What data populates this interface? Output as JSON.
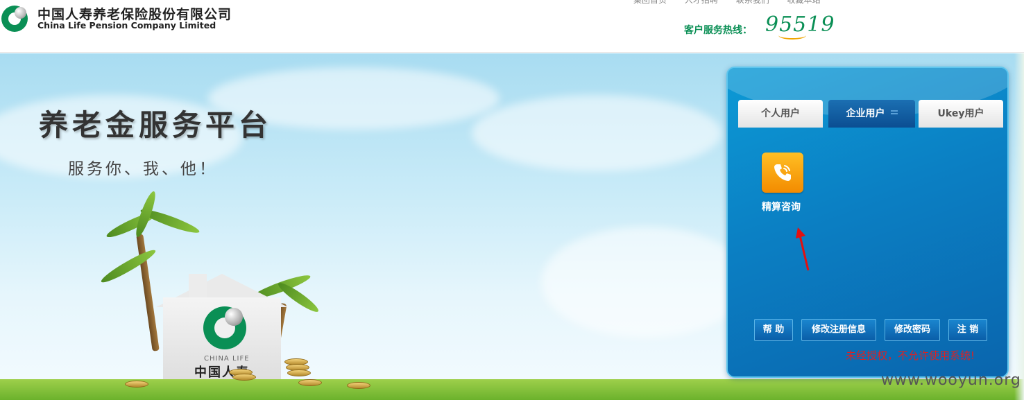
{
  "header": {
    "logo_cn": "中国人寿养老保险股份有限公司",
    "logo_en": "China Life Pension Company Limited",
    "top_links": [
      "集团首页",
      "人才招聘",
      "联系我们",
      "收藏本站"
    ],
    "hotline_label": "客户服务热线：",
    "hotline_number": "95519"
  },
  "hero": {
    "slogan_main": "养老金服务平台",
    "slogan_sub": "服务你、我、他！",
    "house_logo_en": "CHINA LIFE",
    "house_logo_cn": "中国人寿"
  },
  "login_panel": {
    "tabs": [
      {
        "label": "个人用户",
        "active": false
      },
      {
        "label": "企业用户",
        "active": true
      },
      {
        "label": "Ukey用户",
        "active": false
      }
    ],
    "function_icon": {
      "icon": "phone-icon",
      "label": "精算咨询"
    },
    "buttons": [
      "帮 助",
      "修改注册信息",
      "修改密码",
      "注 销"
    ],
    "warning": "未经授权，不允许使用系统!"
  },
  "watermark": "www.wooyun.org",
  "colors": {
    "brand_green": "#0a8f55",
    "panel_blue": "#0b7fc3",
    "warning_red": "#e02020",
    "icon_orange": "#f5a000"
  }
}
